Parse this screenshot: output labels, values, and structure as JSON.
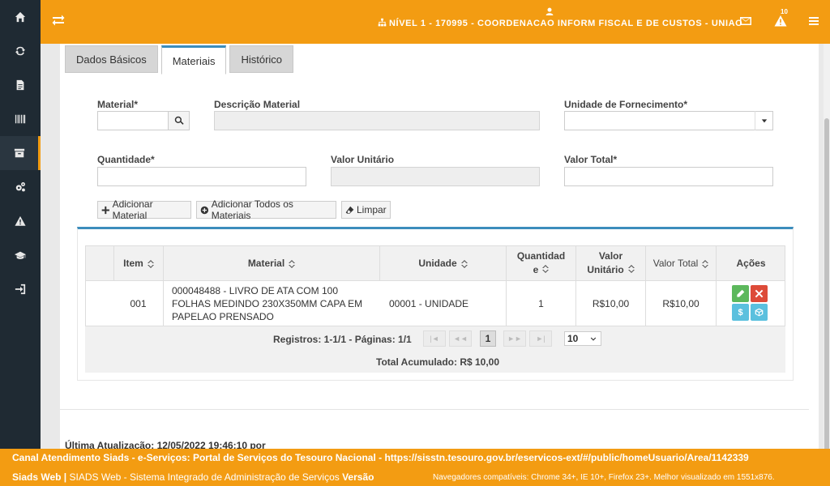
{
  "topbar": {
    "user_line": "NÍVEL 1 - 170995 - COORDENACAO INFORM FISCAL E DE CUSTOS - UNIAO",
    "alert_count": "10"
  },
  "tabs": [
    {
      "label": "Dados Básicos"
    },
    {
      "label": "Materiais"
    },
    {
      "label": "Histórico"
    }
  ],
  "form": {
    "material_label": "Material*",
    "descricao_label": "Descrição Material",
    "unidade_label": "Unidade de Fornecimento*",
    "quantidade_label": "Quantidade*",
    "valor_unitario_label": "Valor Unitário",
    "valor_total_label": "Valor Total*"
  },
  "buttons": {
    "adicionar_material": "Adicionar Material",
    "adicionar_todos": "Adicionar Todos os Materiais",
    "limpar": "Limpar"
  },
  "table": {
    "headers": {
      "item": "Item",
      "material": "Material",
      "unidade": "Unidade",
      "quantidade_1": "Quantidad",
      "quantidade_2": "e",
      "valor_unitario_1": "Valor",
      "valor_unitario_2": "Unitário",
      "valor_total": "Valor Total",
      "acoes": "Ações"
    },
    "rows": [
      {
        "item": "001",
        "material_1": "000048488 - LIVRO DE ATA COM 100",
        "material_2": "FOLHAS MEDINDO 230X350MM CAPA EM",
        "material_3": "PAPELAO PRENSADO",
        "unidade": "00001 - UNIDADE",
        "quantidade": "1",
        "valor_unitario": "R$10,00",
        "valor_total": "R$10,00"
      }
    ],
    "pager": {
      "registros": "Registros: 1-1/1 - Páginas: 1/1",
      "current_page": "1",
      "page_size": "10"
    },
    "total": "Total Acumulado: R$ 10,00"
  },
  "last_update": "Última Atualização: 12/05/2022 19:46:10 por",
  "footer": {
    "line1": "Canal Atendimento Siads - e-Serviços: Portal de Serviços do Tesouro Nacional - https://sisstn.tesouro.gov.br/eservicos-ext/#/public/homeUsuario/Area/1142339",
    "siads_web": "Siads Web |",
    "system_name": " SIADS Web - Sistema Integrado de Administração de Serviços ",
    "versao": "Versão",
    "browsers": "Navegadores compatíveis: Chrome 34+, IE 10+, Firefox 23+. Melhor visualizado em 1551x876."
  },
  "colors": {
    "brand": "#f39c12",
    "sidebar": "#1f2a33",
    "accent_blue": "#3c8dbc",
    "edit": "#5cb85c",
    "delete": "#dd4b39",
    "info": "#5bc0de"
  },
  "icons": [
    "home-icon",
    "refresh-icon",
    "document-icon",
    "barcode-icon",
    "archive-icon",
    "gears-icon",
    "warning-icon",
    "graduation-cap-icon",
    "sign-in-icon",
    "exchange-icon",
    "user-icon",
    "sitemap-icon",
    "envelope-icon",
    "alert-icon",
    "menu-icon",
    "search-icon",
    "caret-down-icon",
    "plus-icon",
    "plus-circle-icon",
    "eraser-icon",
    "sort-icon",
    "pencil-icon",
    "close-icon",
    "dollar-icon",
    "cube-icon"
  ]
}
